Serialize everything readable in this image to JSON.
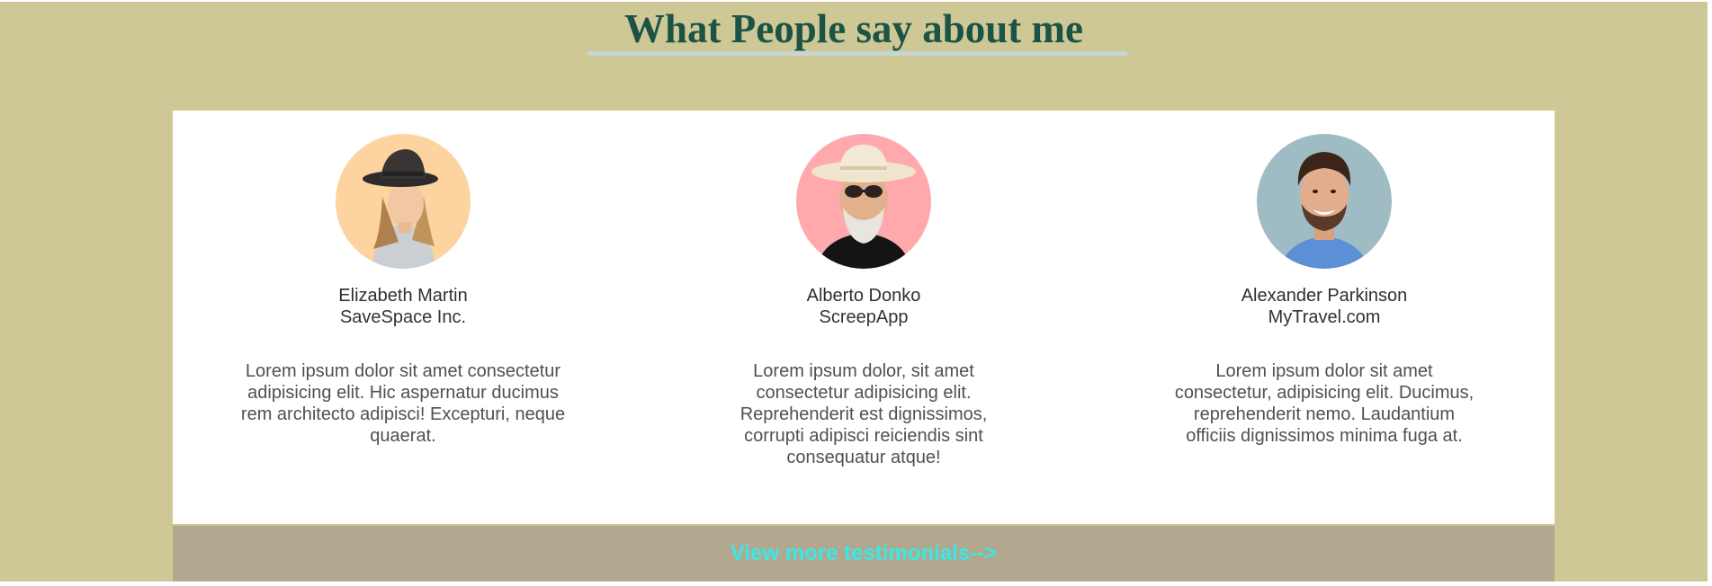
{
  "section": {
    "title": "What People say about me",
    "background_color": "#cec896",
    "title_color": "#1c5344",
    "underline_color": "#c6d6d2"
  },
  "testimonials": [
    {
      "name": "Elizabeth Martin",
      "company": "SaveSpace Inc.",
      "quote": "Lorem ipsum dolor sit amet consectetur adipisicing elit. Hic aspernatur ducimus rem architecto adipisci! Excepturi, neque quaerat.",
      "avatar_bg": "#fdd3a0",
      "avatar_icon": "woman-in-hat-avatar"
    },
    {
      "name": "Alberto Donko",
      "company": "ScreepApp",
      "quote": "Lorem ipsum dolor, sit amet consectetur adipisicing elit. Reprehenderit est dignissimos, corrupti adipisci reiciendis sint consequatur atque!",
      "avatar_bg": "#ffa9ad",
      "avatar_icon": "man-in-cowboy-hat-avatar"
    },
    {
      "name": "Alexander Parkinson",
      "company": "MyTravel.com",
      "quote": "Lorem ipsum dolor sit amet consectetur, adipisicing elit. Ducimus, reprehenderit nemo. Laudantium officiis dignissimos minima fuga at.",
      "avatar_bg": "#9fbcc4",
      "avatar_icon": "smiling-man-avatar"
    }
  ],
  "footer": {
    "link_label": "View more testimonials-->",
    "bar_color": "#b2a890",
    "link_color": "#3be8e6"
  }
}
